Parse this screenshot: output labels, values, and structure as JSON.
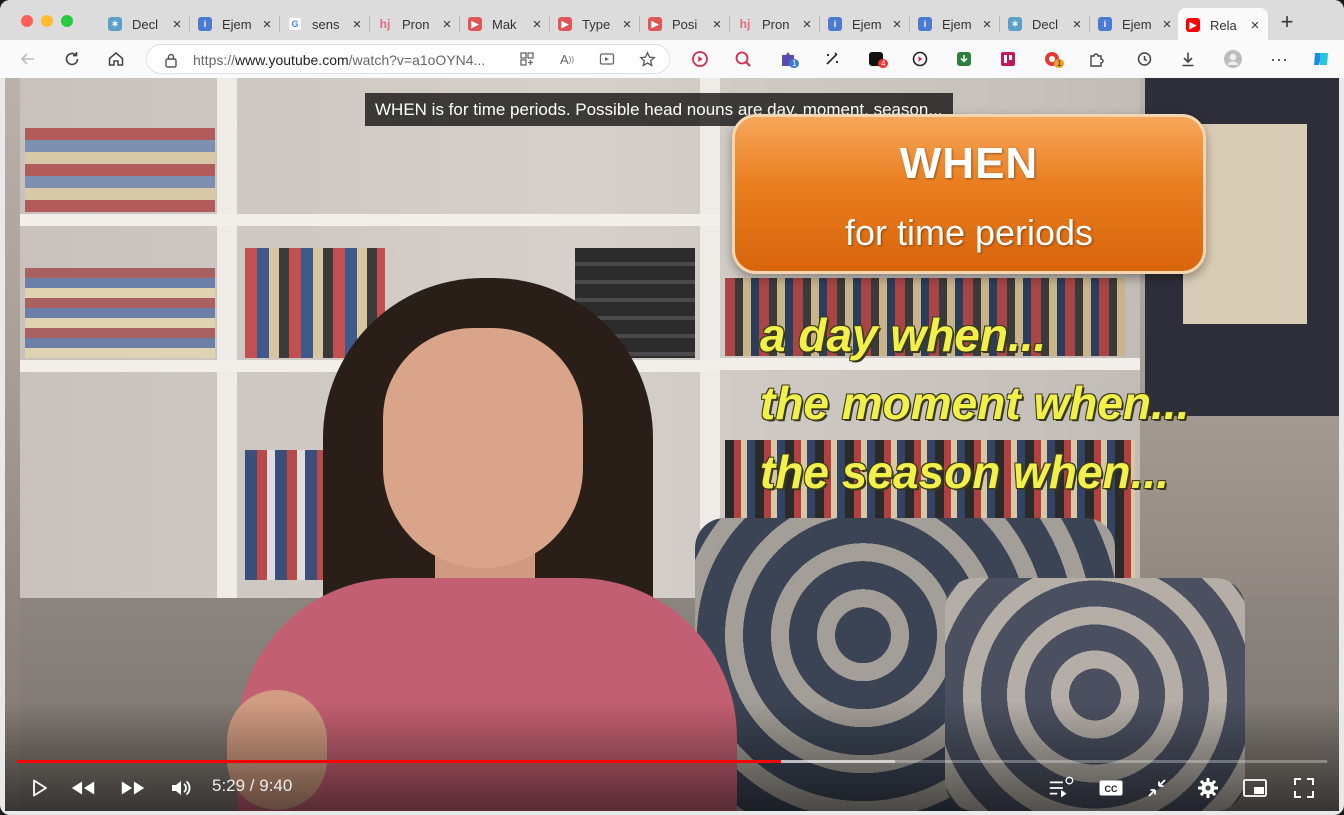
{
  "browser": {
    "tabs": [
      {
        "title": "Decl",
        "favicon": "star-icon",
        "color": "#5aa0c8"
      },
      {
        "title": "Ejem",
        "favicon": "info-icon",
        "color": "#4a7bd0"
      },
      {
        "title": "sens",
        "favicon": "google-icon",
        "color": "#4285f4"
      },
      {
        "title": "Pron",
        "favicon": "hj-icon",
        "color": "#e06d7b"
      },
      {
        "title": "Mak",
        "favicon": "youtube-icon",
        "color": "#e05555"
      },
      {
        "title": "Type",
        "favicon": "youtube-icon",
        "color": "#e05555"
      },
      {
        "title": "Posi",
        "favicon": "youtube-icon",
        "color": "#e05555"
      },
      {
        "title": "Pron",
        "favicon": "hj-icon",
        "color": "#e06d7b"
      },
      {
        "title": "Ejem",
        "favicon": "info-icon",
        "color": "#4a7bd0"
      },
      {
        "title": "Ejem",
        "favicon": "info-icon",
        "color": "#4a7bd0"
      },
      {
        "title": "Decl",
        "favicon": "star-icon",
        "color": "#5aa0c8"
      },
      {
        "title": "Ejem",
        "favicon": "info-icon",
        "color": "#4a7bd0"
      },
      {
        "title": "Rela",
        "favicon": "youtube-icon",
        "color": "#ff0000"
      }
    ],
    "close_glyph": "×",
    "new_tab_glyph": "+",
    "address": {
      "prefix": "https://",
      "host": "www.youtube.com",
      "path": "/watch?v=a1oOYN4..."
    },
    "extension_badges": {
      "puzzle_badge": "1",
      "red_ext_badge": "4",
      "orange_badge": "1"
    }
  },
  "video": {
    "caption": "WHEN is for time periods. Possible head nouns are day, moment, season...",
    "card_title": "WHEN",
    "card_subtitle": "for time periods",
    "examples": [
      "a day when...",
      "the moment when...",
      "the season when..."
    ],
    "time_display": "5:29 / 9:40",
    "progress_fraction": 0.5833,
    "buffer_fraction": 0.67,
    "accent_color": "#ff0000"
  }
}
